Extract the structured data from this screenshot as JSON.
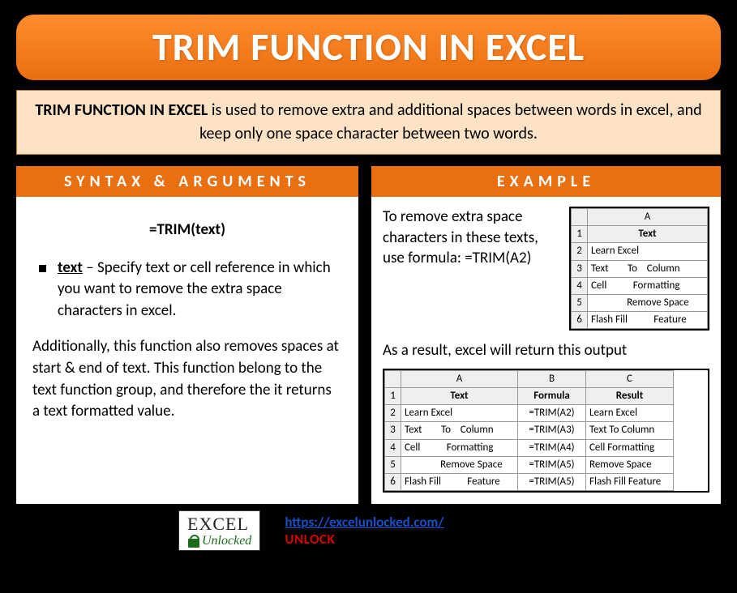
{
  "title": "TRIM FUNCTION IN EXCEL",
  "intro": {
    "bold": "TRIM FUNCTION IN EXCEL",
    "rest": " is used to remove extra and additional spaces between words in excel, and keep only one space character between two words."
  },
  "left": {
    "header": "SYNTAX & ARGUMENTS",
    "syntax": "=TRIM(text)",
    "arg_name": "text",
    "arg_desc": " – Specify text or cell reference in which you want to remove the extra space characters in excel.",
    "additional": "Additionally, this function also removes spaces at start & end of text. This function belong to the text function group, and therefore the it returns a text formatted value."
  },
  "right": {
    "header": "EXAMPLE",
    "intro_text": "To remove extra space characters in these texts, use formula: =TRIM(A2)",
    "table1": {
      "col": "A",
      "header": "Text",
      "rows": [
        "Learn Excel",
        "Text        To    Column",
        "Cell           Formatting",
        "               Remove Space",
        "Flash Fill           Feature"
      ]
    },
    "result_label": "As a result, excel will return this output",
    "table2": {
      "cols": [
        "A",
        "B",
        "C"
      ],
      "headers": [
        "Text",
        "Formula",
        "Result"
      ],
      "rows": [
        [
          "Learn Excel",
          "=TRIM(A2)",
          "Learn Excel"
        ],
        [
          "Text        To    Column",
          "=TRIM(A3)",
          "Text To Column"
        ],
        [
          "Cell           Formatting",
          "=TRIM(A4)",
          "Cell Formatting"
        ],
        [
          "               Remove Space",
          "=TRIM(A5)",
          "Remove Space"
        ],
        [
          "Flash Fill           Feature",
          "=TRIM(A5)",
          "Flash Fill Feature"
        ]
      ]
    }
  },
  "footer": {
    "logo_top": "EXCEL",
    "logo_bottom": "Unlocked",
    "url": "https://excelunlocked.com/",
    "unlock": "UNLOCK"
  }
}
